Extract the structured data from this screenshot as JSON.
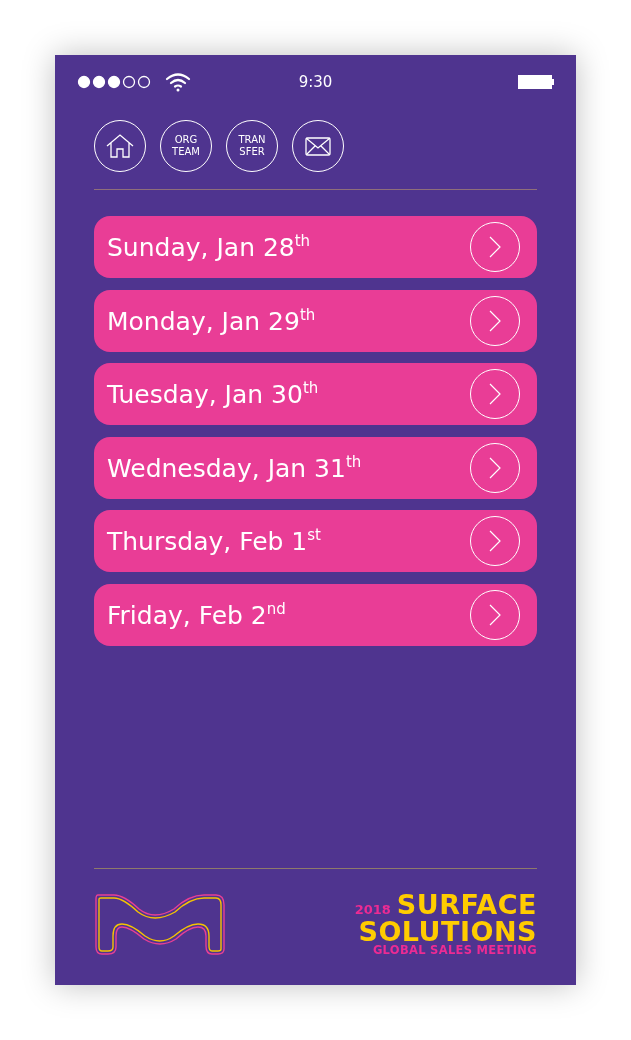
{
  "status_bar": {
    "time": "9:30"
  },
  "nav": [
    {
      "kind": "home"
    },
    {
      "kind": "text",
      "lines": [
        "ORG",
        "TEAM"
      ]
    },
    {
      "kind": "text",
      "lines": [
        "TRAN",
        "SFER"
      ]
    },
    {
      "kind": "mail"
    }
  ],
  "days": [
    {
      "label": "Sunday, Jan 28$^{th}$"
    },
    {
      "label": "Monday, Jan 29$^{th}$"
    },
    {
      "label": "Tuesday, Jan 30$^{th}$"
    },
    {
      "label": "Wednesday, Jan 31$^{th}$"
    },
    {
      "label": "Thursday, Feb 1$^{st}$"
    },
    {
      "label": "Friday, Feb 2$^{nd}$"
    }
  ],
  "footer": {
    "year": "2018",
    "title_lines": [
      "SURFACE",
      "SOLUTIONS"
    ],
    "subtitle": "GLOBAL SALES MEETING"
  }
}
